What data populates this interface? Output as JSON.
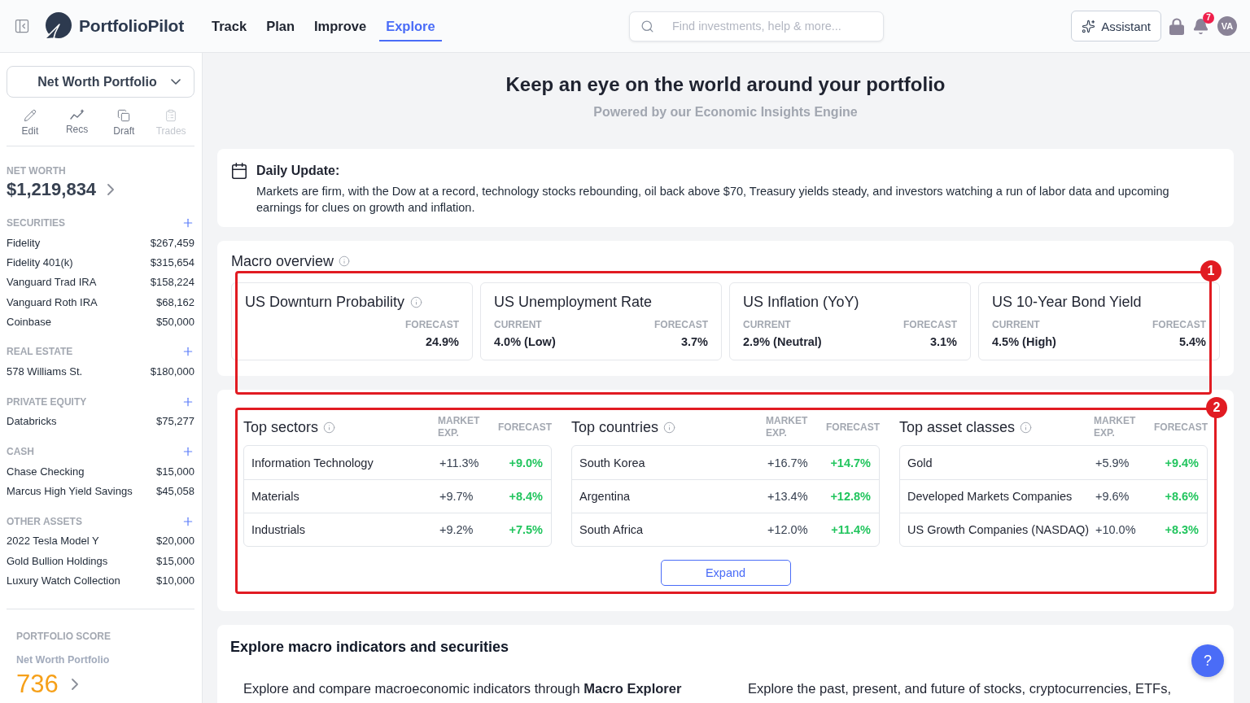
{
  "header": {
    "logo_text": "PortfolioPilot",
    "nav": [
      {
        "label": "Track",
        "selected": false
      },
      {
        "label": "Plan",
        "selected": false
      },
      {
        "label": "Improve",
        "selected": false
      },
      {
        "label": "Explore",
        "selected": true
      }
    ],
    "search": {
      "placeholder": "Find investments, help & more..."
    },
    "assistant_button": "Assistant",
    "notification_count": "7",
    "avatar_initials": "VA"
  },
  "sidebar": {
    "portfolio_select": "Net Worth Portfolio",
    "actions": [
      {
        "label": "Edit",
        "disabled": false
      },
      {
        "label": "Recs",
        "disabled": false
      },
      {
        "label": "Draft",
        "disabled": false
      },
      {
        "label": "Trades",
        "disabled": true
      }
    ],
    "net_worth": {
      "label": "NET WORTH",
      "value": "$1,219,834"
    },
    "sections": [
      {
        "title": "SECURITIES",
        "items": [
          {
            "name": "Fidelity",
            "value": "$267,459"
          },
          {
            "name": "Fidelity 401(k)",
            "value": "$315,654"
          },
          {
            "name": "Vanguard Trad IRA",
            "value": "$158,224"
          },
          {
            "name": "Vanguard Roth IRA",
            "value": "$68,162"
          },
          {
            "name": "Coinbase",
            "value": "$50,000"
          }
        ]
      },
      {
        "title": "REAL ESTATE",
        "items": [
          {
            "name": "578 Williams St.",
            "value": "$180,000"
          }
        ]
      },
      {
        "title": "PRIVATE EQUITY",
        "items": [
          {
            "name": "Databricks",
            "value": "$75,277"
          }
        ]
      },
      {
        "title": "CASH",
        "items": [
          {
            "name": "Chase Checking",
            "value": "$15,000"
          },
          {
            "name": "Marcus High Yield Savings",
            "value": "$45,058"
          }
        ]
      },
      {
        "title": "OTHER ASSETS",
        "items": [
          {
            "name": "2022 Tesla Model Y",
            "value": "$20,000"
          },
          {
            "name": "Gold Bullion Holdings",
            "value": "$15,000"
          },
          {
            "name": "Luxury Watch Collection",
            "value": "$10,000"
          }
        ]
      }
    ],
    "portfolio_score": {
      "label": "PORTFOLIO SCORE",
      "portfolio": "Net Worth Portfolio",
      "score": "736"
    }
  },
  "main": {
    "title": "Keep an eye on the world around your portfolio",
    "subtitle": "Powered by our Economic Insights Engine",
    "daily_update": {
      "title": "Daily Update:",
      "text": "Markets are firm, with the Dow at a record, technology stocks rebounding, oil back above $70, Treasury yields steady, and investors watching a run of labor data and upcoming earnings for clues on growth and inflation."
    },
    "macro_overview": {
      "title": "Macro overview",
      "annotation": "1",
      "cards": [
        {
          "title": "US Downturn Probability",
          "info": true,
          "forecast_label": "FORECAST",
          "forecast": "24.9%"
        },
        {
          "title": "US Unemployment Rate",
          "info": false,
          "current_label": "CURRENT",
          "current": "4.0% (Low)",
          "forecast_label": "FORECAST",
          "forecast": "3.7%"
        },
        {
          "title": "US Inflation (YoY)",
          "info": false,
          "current_label": "CURRENT",
          "current": "2.9% (Neutral)",
          "forecast_label": "FORECAST",
          "forecast": "3.1%"
        },
        {
          "title": "US 10-Year Bond Yield",
          "info": false,
          "current_label": "CURRENT",
          "current": "4.5% (High)",
          "forecast_label": "FORECAST",
          "forecast": "5.4%"
        }
      ]
    },
    "rankings": {
      "annotation": "2",
      "tables": [
        {
          "title": "Top sectors",
          "columns": [
            "MARKET EXP.",
            "FORECAST"
          ],
          "rows": [
            {
              "name": "Information Technology",
              "market_exp": "+11.3%",
              "forecast": "+9.0%"
            },
            {
              "name": "Materials",
              "market_exp": "+9.7%",
              "forecast": "+8.4%"
            },
            {
              "name": "Industrials",
              "market_exp": "+9.2%",
              "forecast": "+7.5%"
            }
          ]
        },
        {
          "title": "Top countries",
          "columns": [
            "MARKET EXP.",
            "FORECAST"
          ],
          "rows": [
            {
              "name": "South Korea",
              "market_exp": "+16.7%",
              "forecast": "+14.7%"
            },
            {
              "name": "Argentina",
              "market_exp": "+13.4%",
              "forecast": "+12.8%"
            },
            {
              "name": "South Africa",
              "market_exp": "+12.0%",
              "forecast": "+11.4%"
            }
          ]
        },
        {
          "title": "Top asset classes",
          "columns": [
            "MARKET EXP.",
            "FORECAST"
          ],
          "rows": [
            {
              "name": "Gold",
              "market_exp": "+5.9%",
              "forecast": "+9.4%"
            },
            {
              "name": "Developed Markets Companies",
              "market_exp": "+9.6%",
              "forecast": "+8.6%"
            },
            {
              "name": "US Growth Companies (NASDAQ)",
              "market_exp": "+10.0%",
              "forecast": "+8.3%"
            }
          ]
        }
      ],
      "expand_button": "Expand"
    },
    "explore": {
      "title": "Explore macro indicators and securities",
      "items": [
        "Explore and compare macroeconomic indicators through **Macro Explorer**",
        "Explore the past, present, and future of stocks, cryptocurrencies, ETFs,"
      ]
    }
  },
  "help_button": "?"
}
